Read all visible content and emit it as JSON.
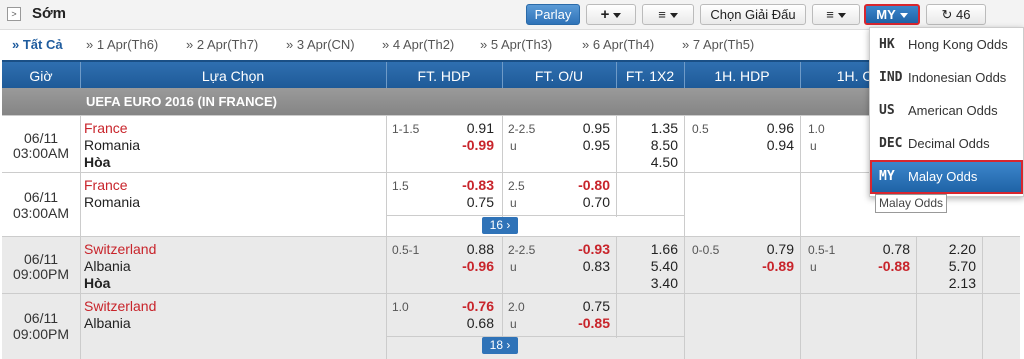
{
  "header": {
    "title": "Sớm",
    "parlay_label": "Parlay",
    "add_icon": "+",
    "sort_icon": "sort-icon",
    "league_select_label": "Chọn Giải Đấu",
    "list_icon": "list-icon",
    "odds_type_label": "MY",
    "refresh_count": "46"
  },
  "date_tabs": [
    "» Tất Cả",
    "» 1 Apr(Th6)",
    "» 2 Apr(Th7)",
    "» 3 Apr(CN)",
    "» 4 Apr(Th2)",
    "» 5 Apr(Th3)",
    "» 6 Apr(Th4)",
    "» 7 Apr(Th5)"
  ],
  "columns": [
    "Giờ",
    "Lựa Chọn",
    "FT. HDP",
    "FT. O/U",
    "FT. 1X2",
    "1H. HDP",
    "1H. O"
  ],
  "league": "UEFA EURO 2016 (IN FRANCE)",
  "matches": [
    {
      "date": "06/11",
      "time": "03:00AM",
      "home": "France",
      "away": "Romania",
      "draw": "Hòa",
      "hdp": "1-1.5",
      "hdp_home": "0.91",
      "hdp_away": "-0.99",
      "ou": "2-2.5",
      "ou_u": "u",
      "ou_over": "0.95",
      "ou_under": "0.95",
      "x12": [
        "1.35",
        "8.50",
        "4.50"
      ],
      "h1_hdp": "0.5",
      "h1_home": "0.96",
      "h1_away": "0.94",
      "h1_ou": "1.0",
      "h1_u": "u"
    },
    {
      "date": "06/11",
      "time": "03:00AM",
      "home": "France",
      "away": "Romania",
      "hdp": "1.5",
      "hdp_home": "-0.83",
      "hdp_away": "0.75",
      "ou": "2.5",
      "ou_u": "u",
      "ou_over": "-0.80",
      "ou_under": "0.70",
      "more": "16"
    },
    {
      "date": "06/11",
      "time": "09:00PM",
      "home": "Switzerland",
      "away": "Albania",
      "draw": "Hòa",
      "hdp": "0.5-1",
      "hdp_home": "0.88",
      "hdp_away": "-0.96",
      "ou": "2-2.5",
      "ou_u": "u",
      "ou_over": "-0.93",
      "ou_under": "0.83",
      "x12": [
        "1.66",
        "5.40",
        "3.40"
      ],
      "h1_hdp": "0-0.5",
      "h1_home": "0.79",
      "h1_away": "-0.89",
      "h1_ou": "0.5-1",
      "h1_u": "u",
      "h1_over": "0.78",
      "h1_under": "-0.88",
      "h1_x12": [
        "2.20",
        "5.70",
        "2.13"
      ]
    },
    {
      "date": "06/11",
      "time": "09:00PM",
      "home": "Switzerland",
      "away": "Albania",
      "hdp": "1.0",
      "hdp_home": "-0.76",
      "hdp_away": "0.68",
      "ou": "2.0",
      "ou_u": "u",
      "ou_over": "0.75",
      "ou_under": "-0.85",
      "more": "18"
    }
  ],
  "odds_menu": [
    {
      "icon": "HK",
      "label": "Hong Kong Odds"
    },
    {
      "icon": "IND",
      "label": "Indonesian Odds"
    },
    {
      "icon": "US",
      "label": "American Odds"
    },
    {
      "icon": "DEC",
      "label": "Decimal Odds"
    },
    {
      "icon": "MY",
      "label": "Malay Odds"
    }
  ],
  "tooltip": "Malay Odds",
  "colors": {
    "header_blue": "#2f6fb0",
    "negative_red": "#c8242b",
    "highlight_border": "#d8262f"
  }
}
